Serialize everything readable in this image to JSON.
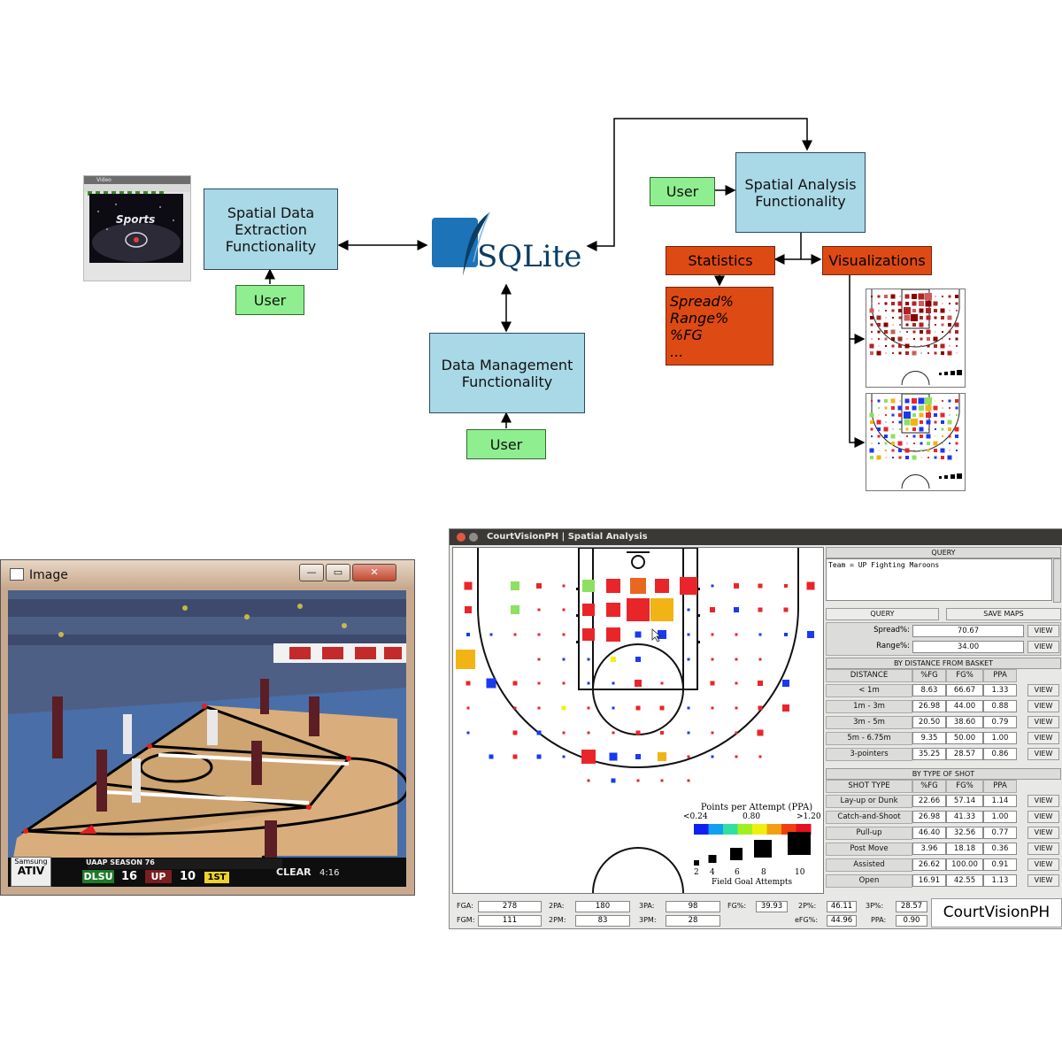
{
  "diagram": {
    "extraction": "Spatial Data\nExtraction\nFunctionality",
    "user1": "User",
    "sqlite_logo": "SQLite",
    "management": "Data Management\nFunctionality",
    "user2": "User",
    "analysis": "Spatial Analysis\nFunctionality",
    "user3": "User",
    "statistics": "Statistics",
    "visualizations": "Visualizations",
    "stats_list": [
      "Spread%",
      "Range%",
      "%FG",
      "..."
    ],
    "video_thumb": {
      "title": "Video",
      "logo": "Sports"
    }
  },
  "image_window": {
    "title": "Image",
    "minimize": "—",
    "maximize": "▭",
    "close": "✕",
    "scoreboard": {
      "brand": "Samsung",
      "brand2": "ATIV",
      "season": "UAAP SEASON 76",
      "team1": "DLSU",
      "score1": "16",
      "team2": "UP",
      "score2": "10",
      "period": "1ST",
      "sponsor": "CLEAR",
      "clock": "4:16"
    }
  },
  "app": {
    "title": "CourtVisionPH | Spatial Analysis",
    "query_header": "QUERY",
    "query_text": "Team = UP Fighting Maroons",
    "query_button": "QUERY",
    "save_button": "SAVE MAPS",
    "spread_label": "Spread%:",
    "spread_value": "70.67",
    "range_label": "Range%:",
    "range_value": "34.00",
    "view": "VIEW",
    "distance_header": "BY DISTANCE FROM BASKET",
    "distance_cols": [
      "DISTANCE",
      "%FG",
      "FG%",
      "PPA"
    ],
    "distance_rows": [
      [
        "< 1m",
        "8.63",
        "66.67",
        "1.33"
      ],
      [
        "1m - 3m",
        "26.98",
        "44.00",
        "0.88"
      ],
      [
        "3m - 5m",
        "20.50",
        "38.60",
        "0.79"
      ],
      [
        "5m - 6.75m",
        "9.35",
        "50.00",
        "1.00"
      ],
      [
        "3-pointers",
        "35.25",
        "28.57",
        "0.86"
      ]
    ],
    "shot_header": "BY TYPE OF SHOT",
    "shot_cols": [
      "SHOT TYPE",
      "%FG",
      "FG%",
      "PPA"
    ],
    "shot_rows": [
      [
        "Lay-up or Dunk",
        "22.66",
        "57.14",
        "1.14"
      ],
      [
        "Catch-and-Shoot",
        "26.98",
        "41.33",
        "1.00"
      ],
      [
        "Pull-up",
        "46.40",
        "32.56",
        "0.77"
      ],
      [
        "Post Move",
        "3.96",
        "18.18",
        "0.36"
      ],
      [
        "Assisted",
        "26.62",
        "100.00",
        "0.91"
      ],
      [
        "Open",
        "16.91",
        "42.55",
        "1.13"
      ]
    ],
    "legend": {
      "title": "Points per Attempt (PPA)",
      "low": "<0.24",
      "mid": "0.80",
      "high": ">1.20",
      "sizes": [
        "2",
        "4",
        "6",
        "8",
        "10"
      ],
      "size_title": "Field Goal Attempts"
    },
    "footer": {
      "fga_label": "FGA:",
      "fga": "278",
      "fgm_label": "FGM:",
      "fgm": "111",
      "twopa_label": "2PA:",
      "twopa": "180",
      "twopm_label": "2PM:",
      "twopm": "83",
      "threepa_label": "3PA:",
      "threepa": "98",
      "threepm_label": "3PM:",
      "threepm": "28",
      "fgp_label": "FG%:",
      "fgp": "39.93",
      "twop_label": "2P%:",
      "twop": "46.11",
      "threep_label": "3P%:",
      "threep": "28.57",
      "efg_label": "eFG%:",
      "efg": "44.96",
      "ppa_label": "PPA:",
      "ppa": "0.90",
      "brand": "CourtVisionPH"
    }
  }
}
